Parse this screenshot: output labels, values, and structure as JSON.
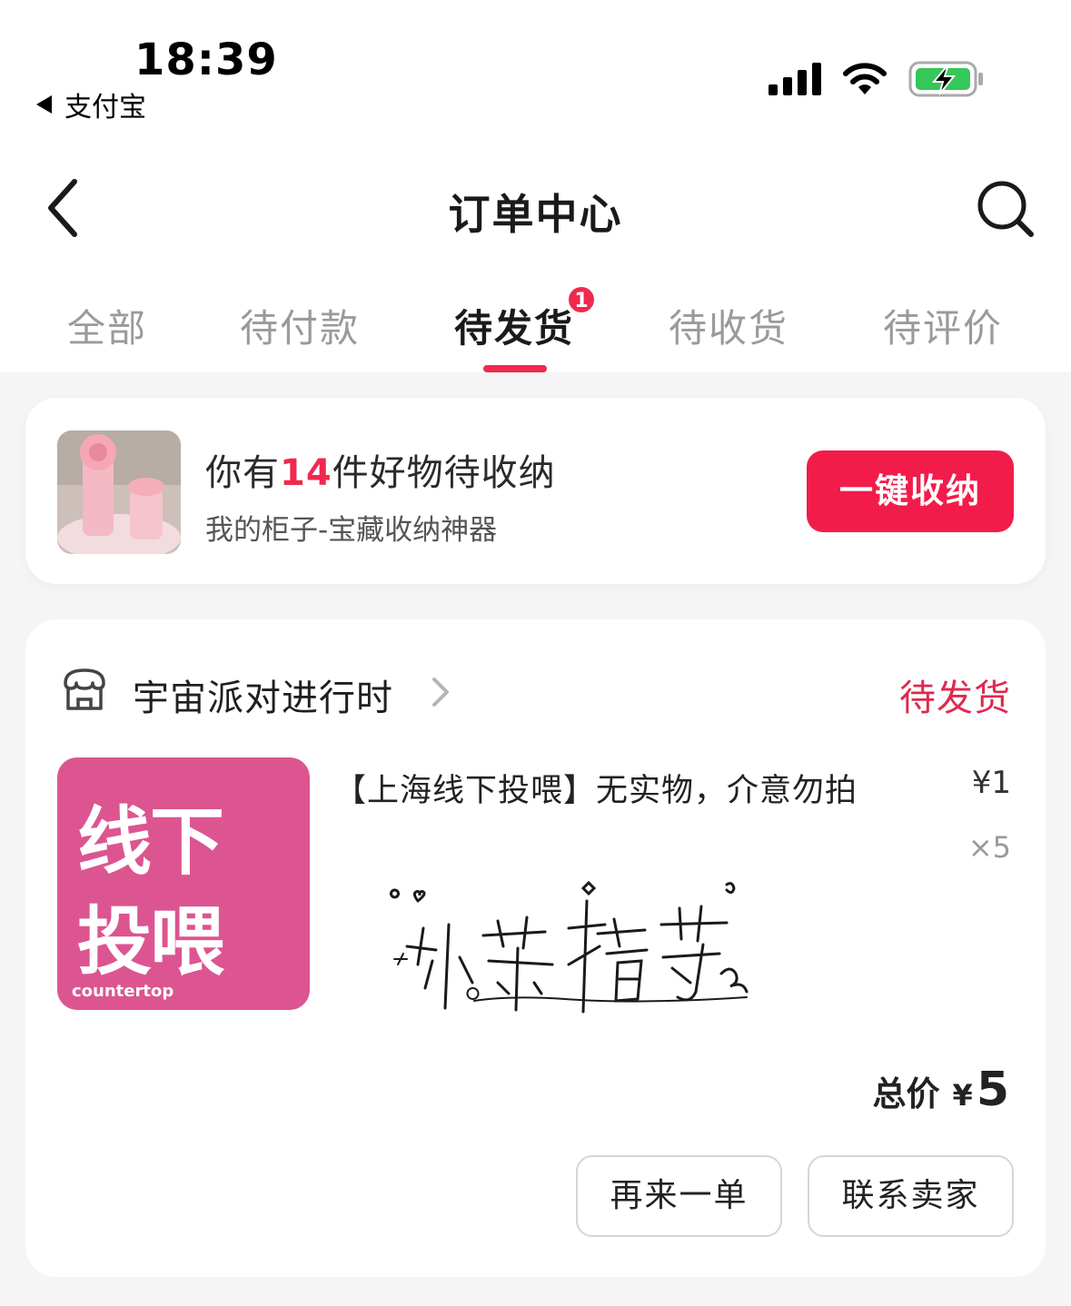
{
  "status_bar": {
    "time": "18:39",
    "back_app": "支付宝",
    "icons": [
      "cellular-signal-icon",
      "wifi-icon",
      "battery-charging-icon"
    ]
  },
  "header": {
    "title": "订单中心",
    "back_icon": "chevron-left-icon",
    "search_icon": "search-icon"
  },
  "tabs": [
    {
      "label": "全部",
      "active": false
    },
    {
      "label": "待付款",
      "active": false
    },
    {
      "label": "待发货",
      "active": true,
      "badge": "1"
    },
    {
      "label": "待收货",
      "active": false
    },
    {
      "label": "待评价",
      "active": false
    }
  ],
  "promo": {
    "title_prefix": "你有",
    "title_count": "14",
    "title_suffix": "件好物待收纳",
    "subtitle": "我的柜子-宝藏收纳神器",
    "button": "一键收纳"
  },
  "order": {
    "shop_name": "宇宙派对进行时",
    "status": "待发货",
    "product": {
      "name": "【上海线下投喂】无实物，介意勿拍",
      "price": "¥1",
      "quantity": "×5",
      "image_text_line1": "线下",
      "image_text_line2": "投喂",
      "image_brand": "countertop"
    },
    "total_label": "总价",
    "total_currency": "¥",
    "total_amount": "5",
    "buttons": {
      "reorder": "再来一单",
      "contact_seller": "联系卖家"
    }
  },
  "colors": {
    "accent": "#f0294f",
    "button_red": "#f21c4b",
    "product_pink": "#dc5591",
    "background": "#f5f5f5"
  }
}
